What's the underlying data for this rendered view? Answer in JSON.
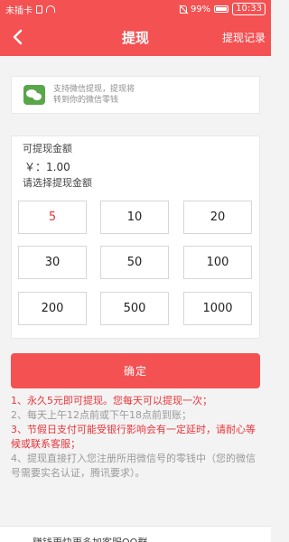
{
  "status_bar": {
    "carrier": "未插卡",
    "battery": "99%",
    "battery_level": 0.99,
    "time": "10:33"
  },
  "nav": {
    "title": "提现",
    "right_link": "提现记录"
  },
  "wechat": {
    "line1": "支持微信提现，提现将",
    "line2": "转到你的微信零钱"
  },
  "amount": {
    "label": "可提现金额",
    "value": "￥：1.00",
    "choose_label": "请选择提现金额",
    "options": [
      "5",
      "10",
      "20",
      "30",
      "50",
      "100",
      "200",
      "500",
      "1000"
    ],
    "selected_index": 0
  },
  "confirm_label": "确定",
  "notes": {
    "n1": "1、永久5元即可提现。您每天可以提现一次；",
    "n2": "2、每天上午12点前或下午18点前到账；",
    "n3": "3、节假日支付可能受银行影响会有一定延时，请耐心等候或联系客服；",
    "n4": "4、提现直接打入您注册所用微信号的零钱中（您的微信号需要实名认证，腾讯要求）。"
  },
  "bottom_teaser": "赚钱更快更多加客服QQ群",
  "colors": {
    "accent": "#f45152",
    "selected_text": "#e8363b",
    "wechat_green": "#5aa64a"
  }
}
